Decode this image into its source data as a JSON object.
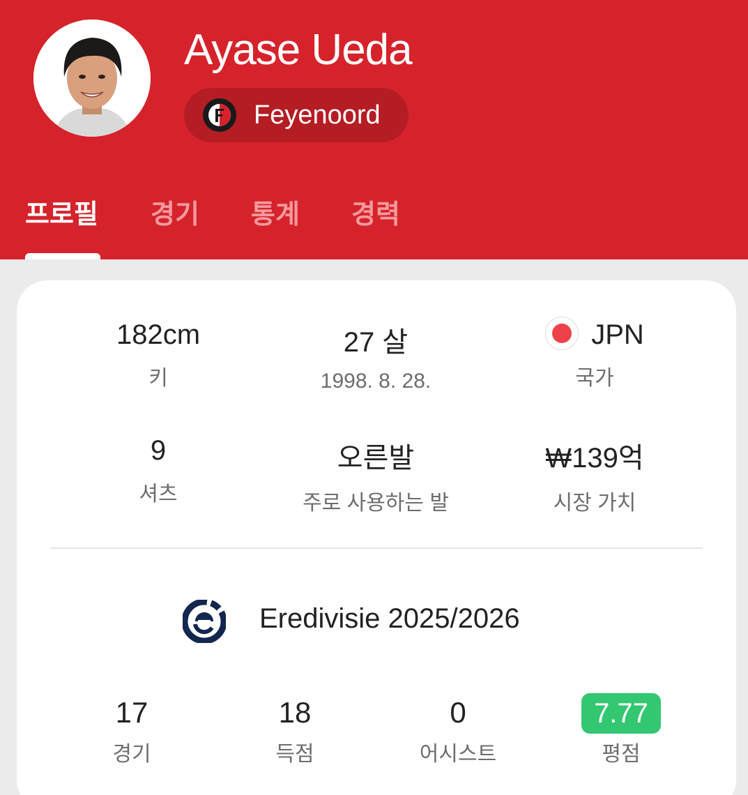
{
  "player": {
    "name": "Ayase Ueda",
    "club": "Feyenoord"
  },
  "tabs": [
    {
      "label": "프로필",
      "active": true
    },
    {
      "label": "경기",
      "active": false
    },
    {
      "label": "통계",
      "active": false
    },
    {
      "label": "경력",
      "active": false
    }
  ],
  "profile": {
    "height": {
      "value": "182cm",
      "label": "키"
    },
    "age": {
      "value": "27 살",
      "label": "1998. 8. 28."
    },
    "country": {
      "value": "JPN",
      "label": "국가"
    },
    "shirt": {
      "value": "9",
      "label": "셔츠"
    },
    "foot": {
      "value": "오른발",
      "label": "주로 사용하는 발"
    },
    "market_value": {
      "value": "₩139억",
      "label": "시장 가치"
    }
  },
  "season": {
    "league": "Eredivisie 2025/2026",
    "stats": [
      {
        "value": "17",
        "label": "경기"
      },
      {
        "value": "18",
        "label": "득점"
      },
      {
        "value": "0",
        "label": "어시스트"
      },
      {
        "value": "7.77",
        "label": "평점"
      }
    ]
  },
  "colors": {
    "header": "#d6232b",
    "club_pill": "#b51d24",
    "rating_badge": "#33c771",
    "flag_dot": "#ef4149"
  },
  "icons": {
    "club_logo": "feyenoord-logo",
    "league_logo": "eredivisie-logo",
    "flag": "japan-flag"
  }
}
